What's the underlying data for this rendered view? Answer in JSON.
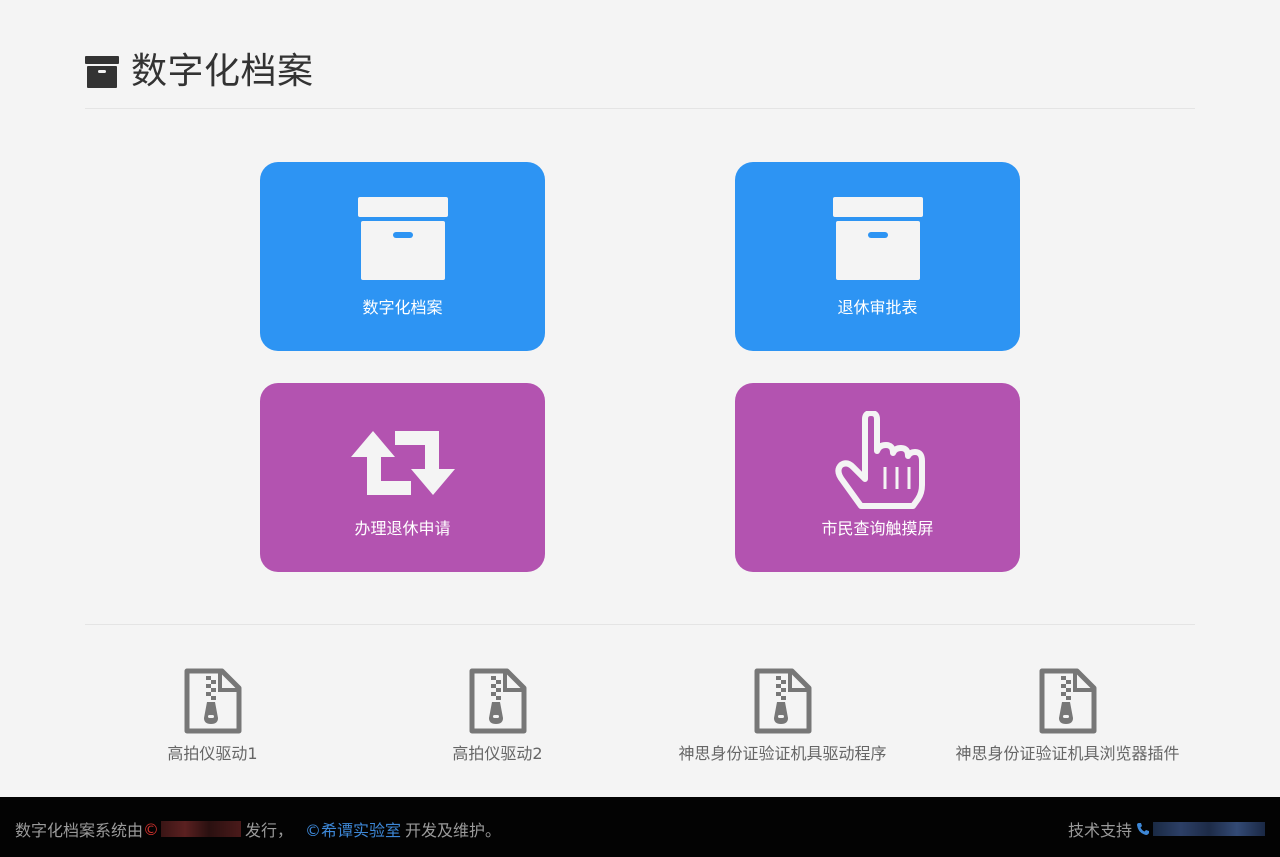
{
  "header": {
    "title": "数字化档案",
    "icon": "archive-icon"
  },
  "tiles": [
    {
      "label": "数字化档案",
      "icon": "archive-box-icon",
      "color": "#2d94f3"
    },
    {
      "label": "退休审批表",
      "icon": "archive-box-icon",
      "color": "#2d94f3"
    },
    {
      "label": "办理退休申请",
      "icon": "retweet-icon",
      "color": "#b353b0"
    },
    {
      "label": "市民查询触摸屏",
      "icon": "hand-pointer-icon",
      "color": "#b353b0"
    }
  ],
  "downloads": [
    {
      "label": "高拍仪驱动1",
      "icon": "zip-file-icon"
    },
    {
      "label": "高拍仪驱动2",
      "icon": "zip-file-icon"
    },
    {
      "label": "神思身份证验证机具驱动程序",
      "icon": "zip-file-icon"
    },
    {
      "label": "神思身份证验证机具浏览器插件",
      "icon": "zip-file-icon"
    }
  ],
  "footer": {
    "prefix": "数字化档案系统由",
    "copy_symbol": "©",
    "issued": "发行，",
    "lab_link": "©希谭实验室",
    "maintain": "开发及维护。",
    "support_label": "技术支持"
  },
  "colors": {
    "blue": "#2d94f3",
    "purple": "#b353b0",
    "footer_bg": "#030303",
    "link": "#3d87d6"
  }
}
